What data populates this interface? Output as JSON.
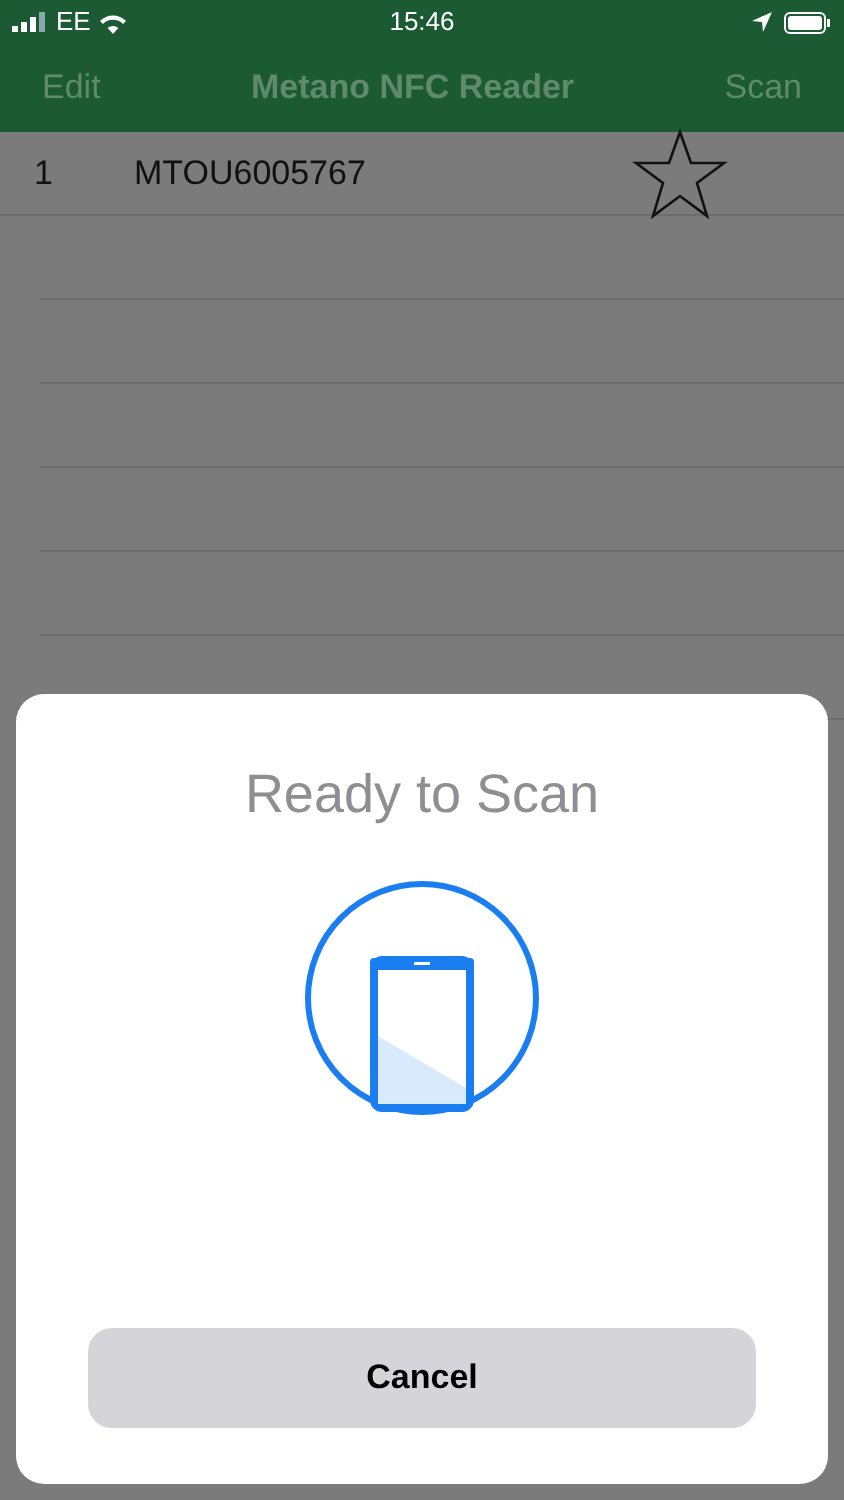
{
  "status_bar": {
    "carrier": "EE",
    "time": "15:46"
  },
  "nav_bar": {
    "left": "Edit",
    "title": "Metano NFC Reader",
    "right": "Scan"
  },
  "rows": [
    {
      "number": "1",
      "tag_id": "MTOU6005767",
      "starred": false
    }
  ],
  "scan_sheet": {
    "title": "Ready to Scan",
    "cancel": "Cancel"
  }
}
